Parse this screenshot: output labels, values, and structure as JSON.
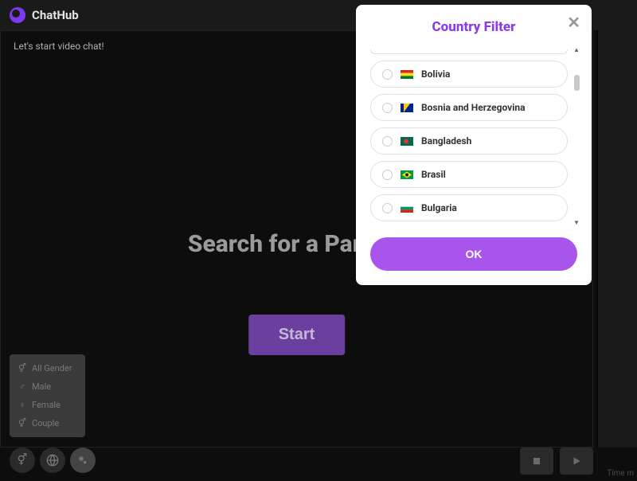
{
  "app": {
    "name": "ChatHub"
  },
  "main": {
    "start_text": "Let's start video chat!",
    "search_heading": "Search for a Partner",
    "start_button": "Start"
  },
  "gender_options": {
    "all": "All Gender",
    "male": "Male",
    "female": "Female",
    "couple": "Couple"
  },
  "modal": {
    "title": "Country Filter",
    "ok_label": "OK",
    "countries": [
      {
        "name": "Bolivia",
        "flag_colors": [
          "#d52b1e",
          "#ffe000",
          "#007934"
        ]
      },
      {
        "name": "Bosnia and Herzegovina",
        "flag_colors": [
          "#002395",
          "#fecb00"
        ]
      },
      {
        "name": "Bangladesh",
        "flag_colors": [
          "#006a4e",
          "#f42a41"
        ]
      },
      {
        "name": "Brasil",
        "flag_colors": [
          "#009c3b",
          "#ffdf00",
          "#002776"
        ]
      },
      {
        "name": "Bulgaria",
        "flag_colors": [
          "#ffffff",
          "#00966e",
          "#d62612"
        ]
      }
    ]
  },
  "footer": {
    "time_label": "Time m"
  }
}
